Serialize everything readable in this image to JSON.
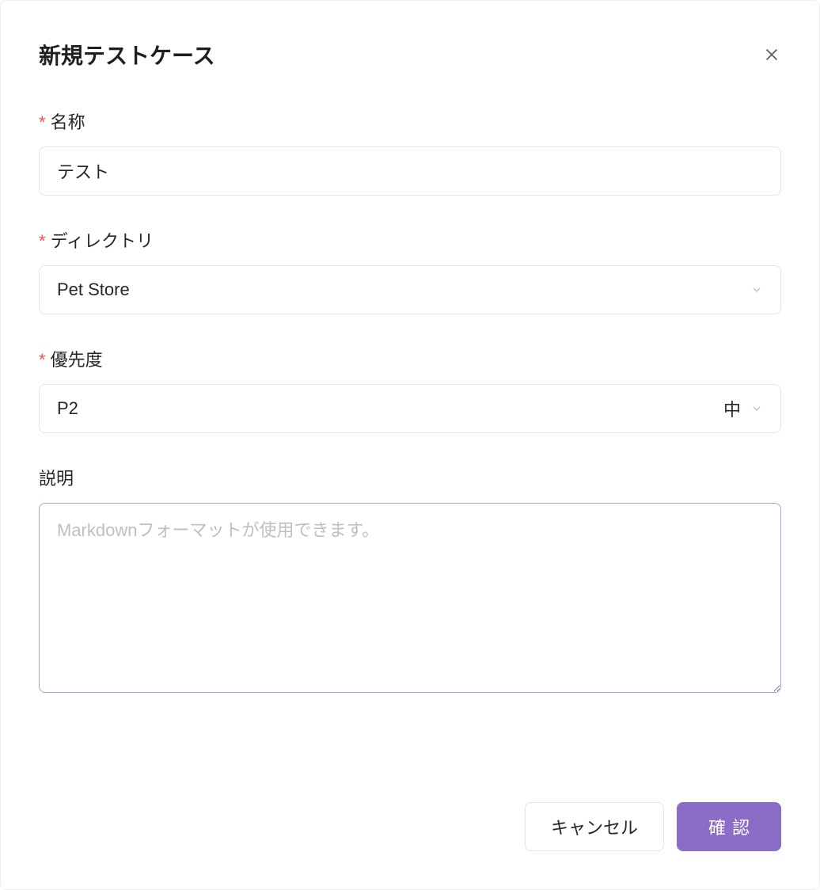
{
  "modal": {
    "title": "新規テストケース",
    "fields": {
      "name": {
        "label": "名称",
        "required": true,
        "value": "テスト"
      },
      "directory": {
        "label": "ディレクトリ",
        "required": true,
        "value": "Pet Store"
      },
      "priority": {
        "label": "優先度",
        "required": true,
        "value": "P2",
        "extra": "中"
      },
      "description": {
        "label": "説明",
        "required": false,
        "placeholder": "Markdownフォーマットが使用できます。",
        "value": ""
      }
    },
    "buttons": {
      "cancel": "キャンセル",
      "confirm": "確認"
    }
  }
}
